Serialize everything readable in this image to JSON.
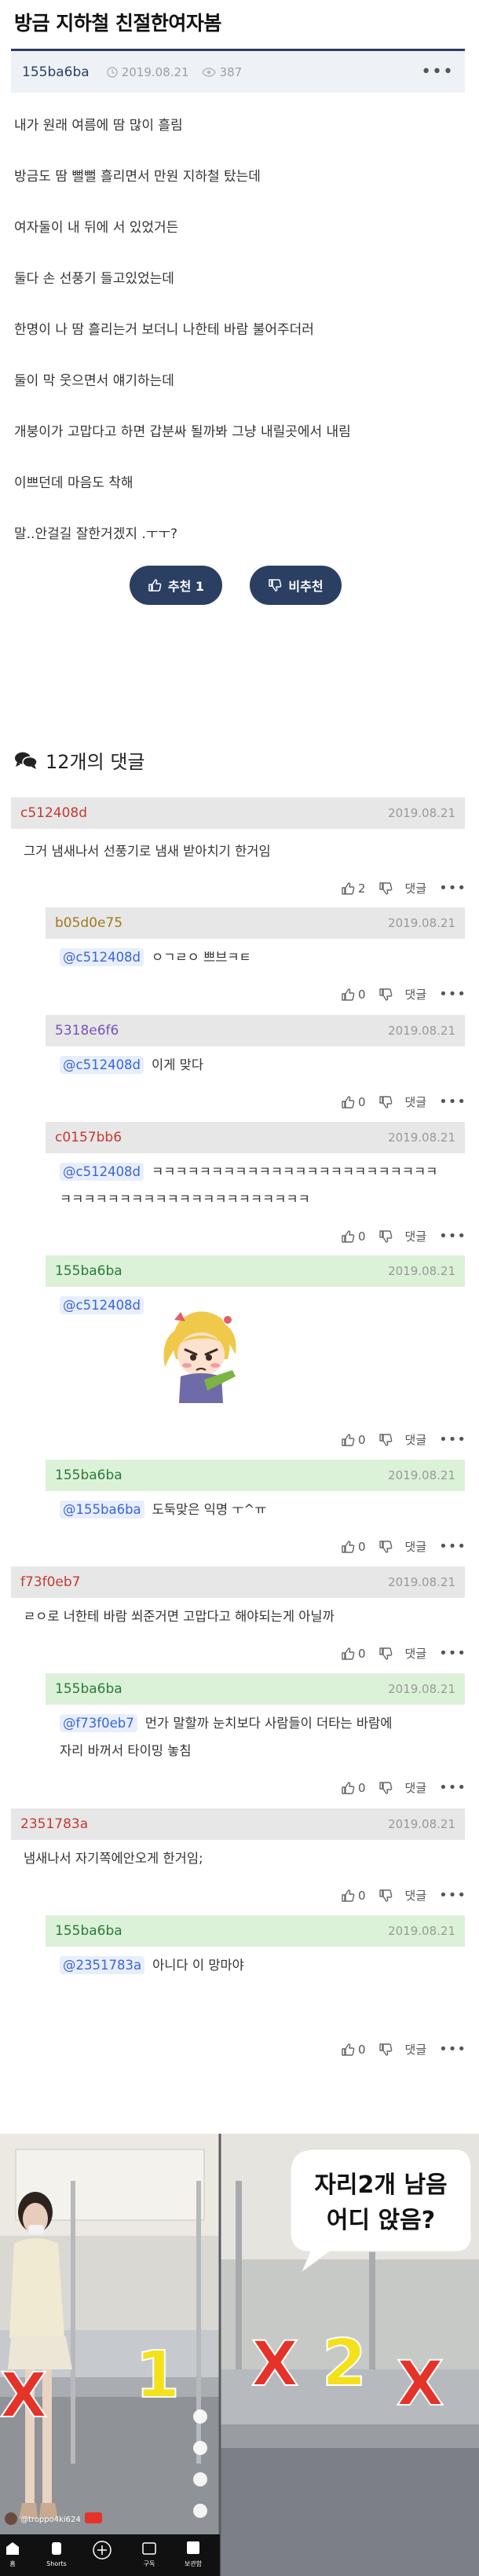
{
  "post": {
    "title": "방금 지하철 친절한여자봄",
    "author": "155ba6ba",
    "date": "2019.08.21",
    "views": "387",
    "body": [
      "내가 원래 여름에 땀 많이 흘림",
      "방금도 땀 뻘뻘 흘리면서 만원 지하철 탔는데",
      "여자둘이 내 뒤에 서 있었거든",
      "둘다 손 선풍기 들고있었는데",
      "한명이 나 땀 흘리는거 보더니  나한테 바람 불어주더러",
      "둘이 막 웃으면서 얘기하는데",
      "개붕이가 고맙다고 하면 갑분싸 될까봐  그냥 내릴곳에서 내림",
      "이쁘던데 마음도 착해",
      "말..안걸길 잘한거겠지 .ㅜㅜ?"
    ],
    "upvote_label": "추천 1",
    "downvote_label": "비추천"
  },
  "comments_header": "12개의 댓글",
  "reply_label": "댓글",
  "comments": [
    {
      "author": "c512408d",
      "date": "2019.08.21",
      "mention": "",
      "text": "그거 냄새나서 선풍기로 냄새 받아치기 한거임",
      "likes": "2",
      "dislikes": ""
    },
    {
      "author": "b05d0e75",
      "date": "2019.08.21",
      "mention": "@c512408d",
      "text": "ㅇㄱㄹㅇ 쁘브ㅋㅌ",
      "likes": "0",
      "dislikes": ""
    },
    {
      "author": "5318e6f6",
      "date": "2019.08.21",
      "mention": "@c512408d",
      "text": "이게 맞다",
      "likes": "0",
      "dislikes": ""
    },
    {
      "author": "c0157bb6",
      "date": "2019.08.21",
      "mention": "@c512408d",
      "text": "ㅋㅋㅋㅋㅋㅋㅋㅋㅋㅋㅋㅋㅋㅋㅋㅋㅋㅋㅋㅋㅋㅋㅋㅋ",
      "text2": "ㅋㅋㅋㅋㅋㅋㅋㅋㅋㅋㅋㅋㅋㅋㅋㅋㅋㅋㅋㅋㅋ",
      "likes": "0",
      "dislikes": ""
    },
    {
      "author": "155ba6ba",
      "date": "2019.08.21",
      "mention": "@c512408d",
      "text": "",
      "likes": "0",
      "dislikes": ""
    },
    {
      "author": "155ba6ba",
      "date": "2019.08.21",
      "mention": "@155ba6ba",
      "text": "도둑맞은 익명 ㅜ^ㅠ",
      "likes": "0",
      "dislikes": ""
    },
    {
      "author": "f73f0eb7",
      "date": "2019.08.21",
      "mention": "",
      "text": "ㄹㅇ로 너한테 바람 쐬준거면 고맙다고 해야되는게 아닐까",
      "likes": "0",
      "dislikes": ""
    },
    {
      "author": "155ba6ba",
      "date": "2019.08.21",
      "mention": "@f73f0eb7",
      "text": "먼가 말할까 눈치보다 사람들이 더타는 바람에",
      "text2": "자리 바꺼서 타이밍 놓침",
      "likes": "0",
      "dislikes": ""
    },
    {
      "author": "2351783a",
      "date": "2019.08.21",
      "mention": "",
      "text": "냄새나서 자기쪽에안오게 한거임;",
      "likes": "0",
      "dislikes": ""
    },
    {
      "author": "155ba6ba",
      "date": "2019.08.21",
      "mention": "@2351783a",
      "text": "아니다 이 망마야",
      "likes": "0",
      "dislikes": ""
    }
  ],
  "photo": {
    "bubble_line1": "자리2개 남음",
    "bubble_line2": "어디 앉음?",
    "mark_x": "X",
    "mark_1": "1",
    "mark_2": "2",
    "user_tag": "@troppo4ki624",
    "nav": [
      "홈",
      "Shorts",
      "",
      "구독",
      "보관함"
    ]
  },
  "colors": {
    "accent": "#2b3f63",
    "gray_bar": "#e7e7e7",
    "green_bar": "#dcf2d8",
    "mention": "#3b66d4",
    "mark_red": "#e5332a",
    "mark_yellow": "#f4e11c"
  }
}
